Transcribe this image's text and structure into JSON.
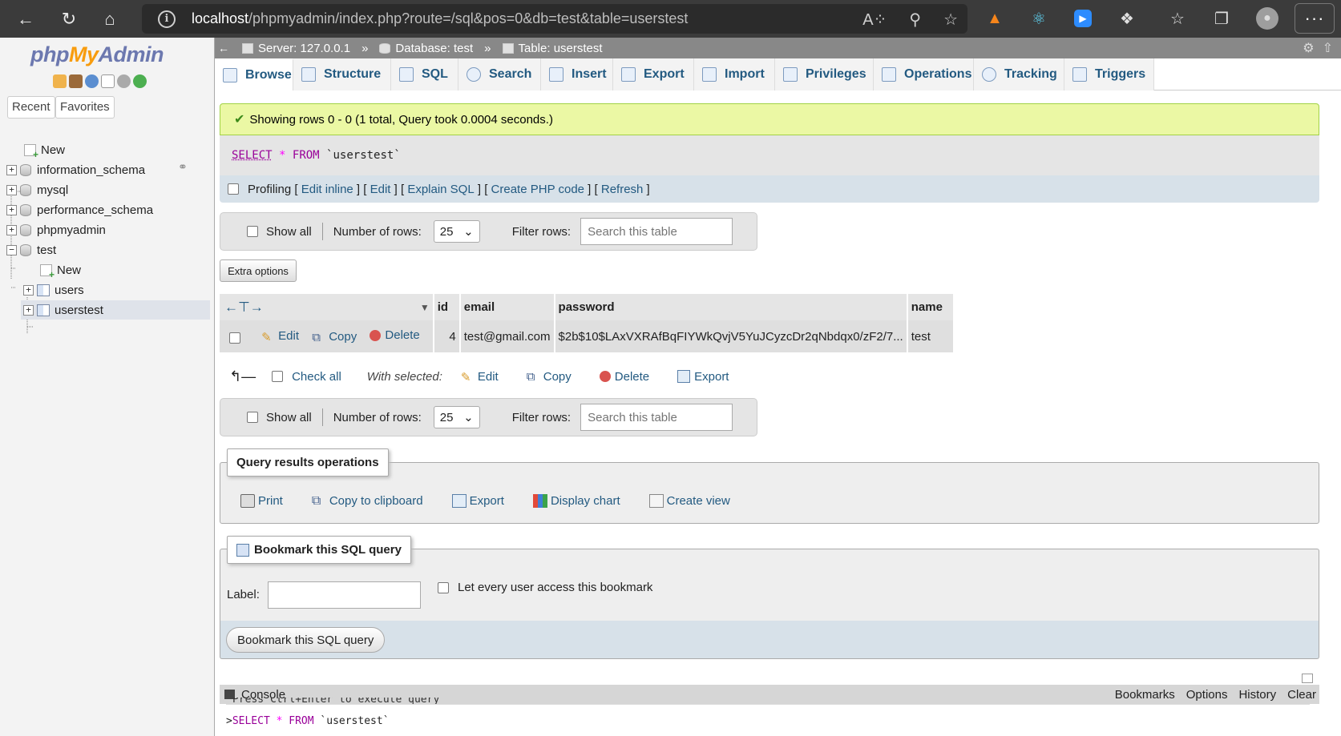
{
  "browser": {
    "url_host": "localhost",
    "url_path": "/phpmyadmin/index.php?route=/sql&pos=0&db=test&table=userstest"
  },
  "logo": {
    "php": "php",
    "my": "My",
    "admin": "Admin"
  },
  "nav_tabs": {
    "recent": "Recent",
    "favorites": "Favorites"
  },
  "tree": {
    "new": "New",
    "dbs": [
      "information_schema",
      "mysql",
      "performance_schema",
      "phpmyadmin",
      "test"
    ],
    "test_new": "New",
    "tables": [
      "users",
      "userstest"
    ]
  },
  "breadcrumb": {
    "server": "Server: 127.0.0.1",
    "database": "Database: test",
    "table": "Table: userstest",
    "sep": "»"
  },
  "tabs": [
    "Browse",
    "Structure",
    "SQL",
    "Search",
    "Insert",
    "Export",
    "Import",
    "Privileges",
    "Operations",
    "Tracking",
    "Triggers"
  ],
  "message": "Showing rows 0 - 0 (1 total, Query took 0.0004 seconds.)",
  "sql": {
    "select": "SELECT",
    "star": "*",
    "from": "FROM",
    "table": "`userstest`"
  },
  "profiling": {
    "label": "Profiling",
    "links": [
      "Edit inline",
      "Edit",
      "Explain SQL",
      "Create PHP code",
      "Refresh"
    ]
  },
  "navigation": {
    "show_all": "Show all",
    "rows_label": "Number of rows:",
    "rows_value": "25",
    "filter_label": "Filter rows:",
    "filter_placeholder": "Search this table"
  },
  "extra_options": "Extra options",
  "table": {
    "columns": [
      "id",
      "email",
      "password",
      "name"
    ],
    "row": {
      "edit": "Edit",
      "copy": "Copy",
      "delete": "Delete",
      "id": "4",
      "email": "test@gmail.com",
      "password": "$2b$10$LAxVXRAfBqFIYWkQvjV5YuJCyzcDr2qNbdqx0/zF2/7...",
      "name": "test"
    }
  },
  "with_selected": {
    "check_all": "Check all",
    "label": "With selected:",
    "edit": "Edit",
    "copy": "Copy",
    "delete": "Delete",
    "export": "Export"
  },
  "query_ops": {
    "legend": "Query results operations",
    "items": [
      "Print",
      "Copy to clipboard",
      "Export",
      "Display chart",
      "Create view"
    ]
  },
  "bookmark": {
    "legend": "Bookmark this SQL query",
    "label": "Label:",
    "shared": "Let every user access this bookmark",
    "button": "Bookmark this SQL query"
  },
  "console": {
    "title": "Console",
    "links": [
      "Bookmarks",
      "Options",
      "History",
      "Clear"
    ],
    "hint": "Press Ctrl+Enter to execute query",
    "prompt": ">",
    "query": "SELECT * FROM `userstest`"
  }
}
